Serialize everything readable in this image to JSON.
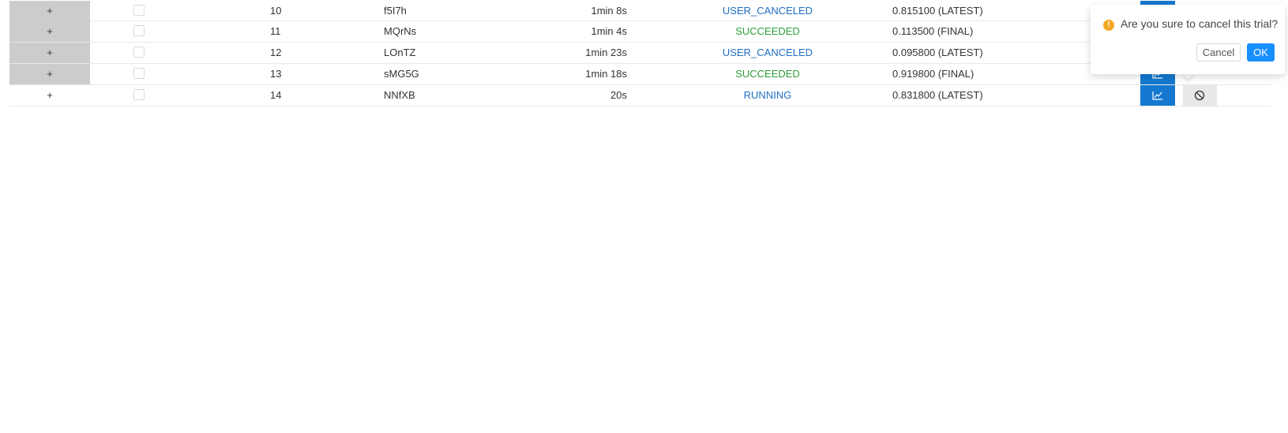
{
  "table": {
    "rows": [
      {
        "expand": "+",
        "id": "10",
        "name": "f5I7h",
        "duration": "1min 8s",
        "status": "USER_CANCELED",
        "status_color": "#1f6fc5",
        "metric": "0.815100 (LATEST)"
      },
      {
        "expand": "+",
        "id": "11",
        "name": "MQrNs",
        "duration": "1min 4s",
        "status": "SUCCEEDED",
        "status_color": "#2e9e3a",
        "metric": "0.113500 (FINAL)"
      },
      {
        "expand": "+",
        "id": "12",
        "name": "LOnTZ",
        "duration": "1min 23s",
        "status": "USER_CANCELED",
        "status_color": "#1f6fc5",
        "metric": "0.095800 (LATEST)"
      },
      {
        "expand": "+",
        "id": "13",
        "name": "sMG5G",
        "duration": "1min 18s",
        "status": "SUCCEEDED",
        "status_color": "#2e9e3a",
        "metric": "0.919800 (FINAL)"
      },
      {
        "expand": "+",
        "id": "14",
        "name": "NNfXB",
        "duration": "20s",
        "status": "RUNNING",
        "status_color": "#1f6fc5",
        "metric": "0.831800 (LATEST)"
      }
    ],
    "icons": {
      "chart": "line-chart-icon",
      "cancel": "stop-icon"
    },
    "accent": "#1478d0"
  },
  "popconfirm": {
    "message": "Are you sure to cancel this trial?",
    "icon": "exclamation-circle-icon",
    "icon_color": "#f5a623",
    "cancel_label": "Cancel",
    "ok_label": "OK",
    "ok_color": "#1890ff"
  }
}
